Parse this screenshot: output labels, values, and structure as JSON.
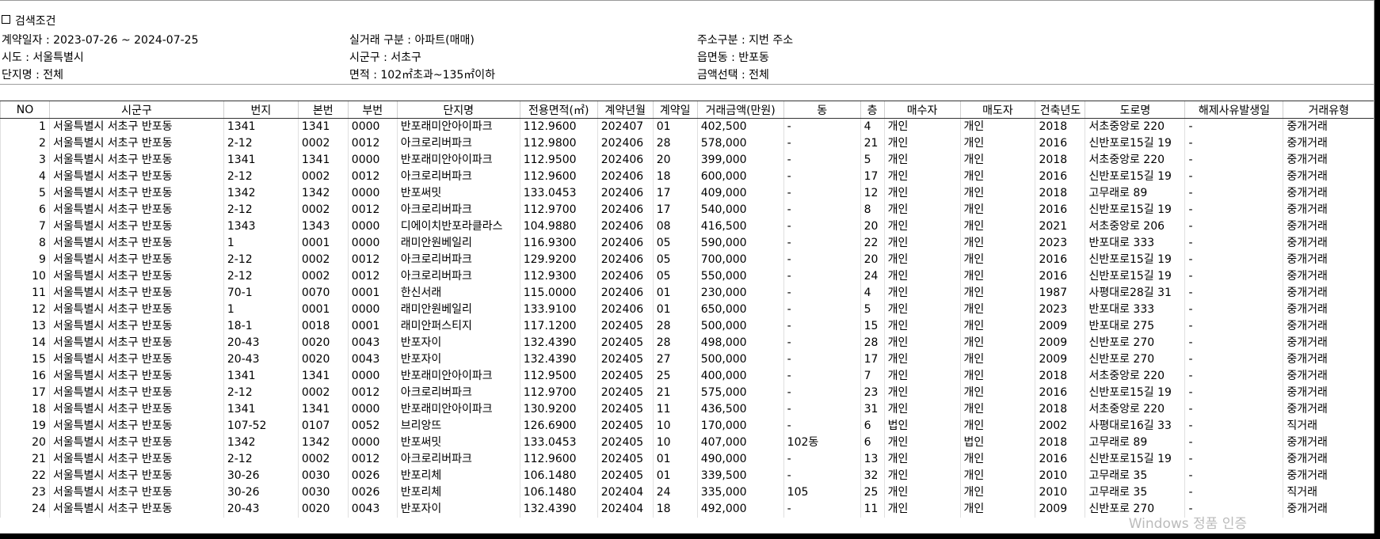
{
  "search": {
    "title": "검색조건",
    "contract_date": "계약일자 : 2023-07-26 ~ 2024-07-25",
    "deal_type": "실거래 구분 : 아파트(매매)",
    "address_type": "주소구분 : 지번 주소",
    "sido": "시도 : 서울특별시",
    "sigungu": "시군구 : 서초구",
    "eupmyeondong": "읍면동 : 반포동",
    "complex": "단지명 : 전체",
    "area": "면적 : 102㎡초과~135㎡이하",
    "amount": "금액선택 : 전체"
  },
  "columns": [
    "NO",
    "시군구",
    "번지",
    "본번",
    "부번",
    "단지명",
    "전용면적(㎡)",
    "계약년월",
    "계약일",
    "거래금액(만원)",
    "동",
    "층",
    "매수자",
    "매도자",
    "건축년도",
    "도로명",
    "해제사유발생일",
    "거래유형"
  ],
  "rows": [
    [
      "1",
      "서울특별시 서초구 반포동",
      "1341",
      "1341",
      "0000",
      "반포래미안아이파크",
      "112.9600",
      "202407",
      "01",
      "402,500",
      "-",
      "4",
      "개인",
      "개인",
      "2018",
      "서초중앙로 220",
      "-",
      "중개거래"
    ],
    [
      "2",
      "서울특별시 서초구 반포동",
      "2-12",
      "0002",
      "0012",
      "아크로리버파크",
      "112.9800",
      "202406",
      "28",
      "578,000",
      "-",
      "21",
      "개인",
      "개인",
      "2016",
      "신반포로15길 19",
      "-",
      "중개거래"
    ],
    [
      "3",
      "서울특별시 서초구 반포동",
      "1341",
      "1341",
      "0000",
      "반포래미안아이파크",
      "112.9500",
      "202406",
      "20",
      "399,000",
      "-",
      "5",
      "개인",
      "개인",
      "2018",
      "서초중앙로 220",
      "-",
      "중개거래"
    ],
    [
      "4",
      "서울특별시 서초구 반포동",
      "2-12",
      "0002",
      "0012",
      "아크로리버파크",
      "112.9600",
      "202406",
      "18",
      "600,000",
      "-",
      "17",
      "개인",
      "개인",
      "2016",
      "신반포로15길 19",
      "-",
      "중개거래"
    ],
    [
      "5",
      "서울특별시 서초구 반포동",
      "1342",
      "1342",
      "0000",
      "반포써밋",
      "133.0453",
      "202406",
      "17",
      "409,000",
      "-",
      "12",
      "개인",
      "개인",
      "2018",
      "고무래로 89",
      "-",
      "중개거래"
    ],
    [
      "6",
      "서울특별시 서초구 반포동",
      "2-12",
      "0002",
      "0012",
      "아크로리버파크",
      "112.9700",
      "202406",
      "17",
      "540,000",
      "-",
      "8",
      "개인",
      "개인",
      "2016",
      "신반포로15길 19",
      "-",
      "중개거래"
    ],
    [
      "7",
      "서울특별시 서초구 반포동",
      "1343",
      "1343",
      "0000",
      "디에이치반포라클라스",
      "104.9880",
      "202406",
      "08",
      "416,500",
      "-",
      "20",
      "개인",
      "개인",
      "2021",
      "서초중앙로 206",
      "-",
      "중개거래"
    ],
    [
      "8",
      "서울특별시 서초구 반포동",
      "1",
      "0001",
      "0000",
      "래미안원베일리",
      "116.9300",
      "202406",
      "05",
      "590,000",
      "-",
      "22",
      "개인",
      "개인",
      "2023",
      "반포대로 333",
      "-",
      "중개거래"
    ],
    [
      "9",
      "서울특별시 서초구 반포동",
      "2-12",
      "0002",
      "0012",
      "아크로리버파크",
      "129.9200",
      "202406",
      "05",
      "700,000",
      "-",
      "20",
      "개인",
      "개인",
      "2016",
      "신반포로15길 19",
      "-",
      "중개거래"
    ],
    [
      "10",
      "서울특별시 서초구 반포동",
      "2-12",
      "0002",
      "0012",
      "아크로리버파크",
      "112.9300",
      "202406",
      "05",
      "550,000",
      "-",
      "24",
      "개인",
      "개인",
      "2016",
      "신반포로15길 19",
      "-",
      "중개거래"
    ],
    [
      "11",
      "서울특별시 서초구 반포동",
      "70-1",
      "0070",
      "0001",
      "한신서래",
      "115.0000",
      "202406",
      "01",
      "230,000",
      "-",
      "4",
      "개인",
      "개인",
      "1987",
      "사평대로28길 31",
      "-",
      "중개거래"
    ],
    [
      "12",
      "서울특별시 서초구 반포동",
      "1",
      "0001",
      "0000",
      "래미안원베일리",
      "133.9100",
      "202406",
      "01",
      "650,000",
      "-",
      "5",
      "개인",
      "개인",
      "2023",
      "반포대로 333",
      "-",
      "중개거래"
    ],
    [
      "13",
      "서울특별시 서초구 반포동",
      "18-1",
      "0018",
      "0001",
      "래미안퍼스티지",
      "117.1200",
      "202405",
      "28",
      "500,000",
      "-",
      "15",
      "개인",
      "개인",
      "2009",
      "반포대로 275",
      "-",
      "중개거래"
    ],
    [
      "14",
      "서울특별시 서초구 반포동",
      "20-43",
      "0020",
      "0043",
      "반포자이",
      "132.4390",
      "202405",
      "28",
      "498,000",
      "-",
      "28",
      "개인",
      "개인",
      "2009",
      "신반포로 270",
      "-",
      "중개거래"
    ],
    [
      "15",
      "서울특별시 서초구 반포동",
      "20-43",
      "0020",
      "0043",
      "반포자이",
      "132.4390",
      "202405",
      "27",
      "500,000",
      "-",
      "17",
      "개인",
      "개인",
      "2009",
      "신반포로 270",
      "-",
      "중개거래"
    ],
    [
      "16",
      "서울특별시 서초구 반포동",
      "1341",
      "1341",
      "0000",
      "반포래미안아이파크",
      "112.9500",
      "202405",
      "25",
      "400,000",
      "-",
      "7",
      "개인",
      "개인",
      "2018",
      "서초중앙로 220",
      "-",
      "중개거래"
    ],
    [
      "17",
      "서울특별시 서초구 반포동",
      "2-12",
      "0002",
      "0012",
      "아크로리버파크",
      "112.9700",
      "202405",
      "21",
      "575,000",
      "-",
      "23",
      "개인",
      "개인",
      "2016",
      "신반포로15길 19",
      "-",
      "중개거래"
    ],
    [
      "18",
      "서울특별시 서초구 반포동",
      "1341",
      "1341",
      "0000",
      "반포래미안아이파크",
      "130.9200",
      "202405",
      "11",
      "436,500",
      "-",
      "31",
      "개인",
      "개인",
      "2018",
      "서초중앙로 220",
      "-",
      "중개거래"
    ],
    [
      "19",
      "서울특별시 서초구 반포동",
      "107-52",
      "0107",
      "0052",
      "브리앙뜨",
      "126.6900",
      "202405",
      "10",
      "170,000",
      "-",
      "6",
      "법인",
      "개인",
      "2002",
      "사평대로16길 33",
      "-",
      "직거래"
    ],
    [
      "20",
      "서울특별시 서초구 반포동",
      "1342",
      "1342",
      "0000",
      "반포써밋",
      "133.0453",
      "202405",
      "10",
      "407,000",
      "102동",
      "6",
      "개인",
      "법인",
      "2018",
      "고무래로 89",
      "-",
      "중개거래"
    ],
    [
      "21",
      "서울특별시 서초구 반포동",
      "2-12",
      "0002",
      "0012",
      "아크로리버파크",
      "112.9600",
      "202405",
      "01",
      "490,000",
      "-",
      "13",
      "개인",
      "개인",
      "2016",
      "신반포로15길 19",
      "-",
      "중개거래"
    ],
    [
      "22",
      "서울특별시 서초구 반포동",
      "30-26",
      "0030",
      "0026",
      "반포리체",
      "106.1480",
      "202405",
      "01",
      "339,500",
      "-",
      "32",
      "개인",
      "개인",
      "2010",
      "고무래로 35",
      "-",
      "중개거래"
    ],
    [
      "23",
      "서울특별시 서초구 반포동",
      "30-26",
      "0030",
      "0026",
      "반포리체",
      "106.1480",
      "202404",
      "24",
      "335,000",
      "105",
      "25",
      "개인",
      "개인",
      "2010",
      "고무래로 35",
      "-",
      "직거래"
    ],
    [
      "24",
      "서울특별시 서초구 반포동",
      "20-43",
      "0020",
      "0043",
      "반포자이",
      "132.4390",
      "202404",
      "18",
      "492,000",
      "-",
      "11",
      "개인",
      "개인",
      "2009",
      "신반포로 270",
      "-",
      "중개거래"
    ]
  ],
  "watermark": "Windows 정품 인증"
}
